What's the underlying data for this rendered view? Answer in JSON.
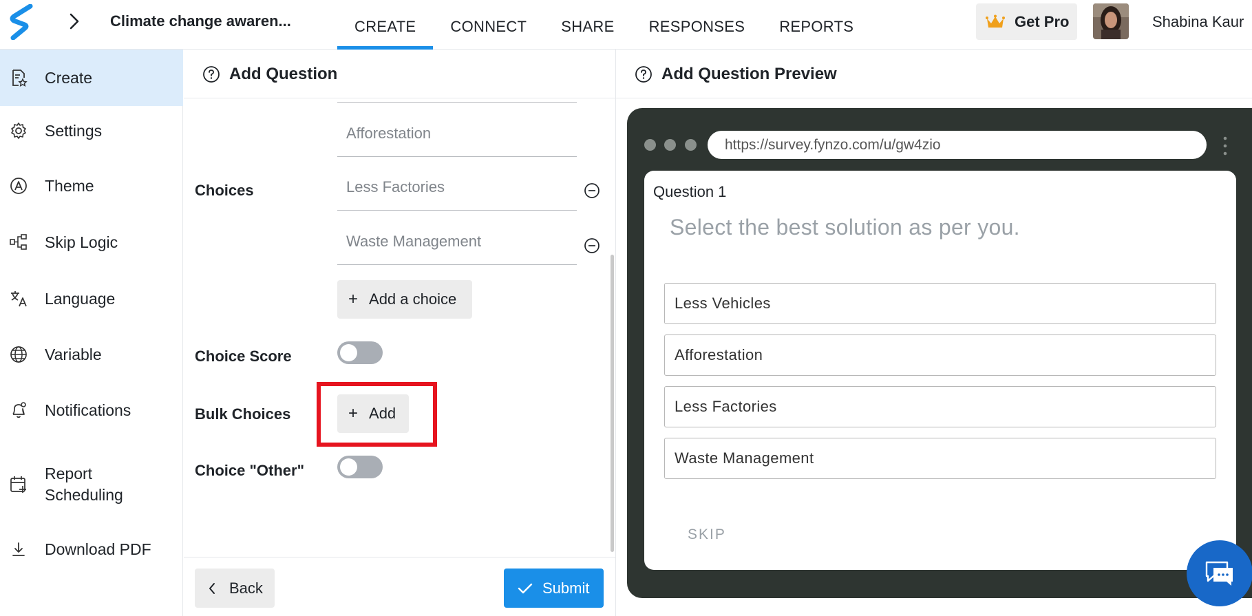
{
  "header": {
    "survey_title": "Climate change awaren...",
    "nav_tabs": [
      {
        "label": "CREATE",
        "active": true
      },
      {
        "label": "CONNECT",
        "active": false
      },
      {
        "label": "SHARE",
        "active": false
      },
      {
        "label": "RESPONSES",
        "active": false
      },
      {
        "label": "REPORTS",
        "active": false
      }
    ],
    "get_pro_label": "Get Pro",
    "username": "Shabina Kaur",
    "accent_color": "#1a8fe8"
  },
  "sidebar": {
    "items": [
      {
        "label": "Create",
        "icon": "create-form-icon",
        "active": true
      },
      {
        "label": "Settings",
        "icon": "gear-icon",
        "active": false
      },
      {
        "label": "Theme",
        "icon": "theme-icon",
        "active": false
      },
      {
        "label": "Skip Logic",
        "icon": "skip-logic-icon",
        "active": false
      },
      {
        "label": "Language",
        "icon": "translate-icon",
        "active": false
      },
      {
        "label": "Variable",
        "icon": "globe-icon",
        "active": false
      },
      {
        "label": "Notifications",
        "icon": "bell-icon",
        "active": false
      },
      {
        "label": "Report Scheduling",
        "icon": "calendar-icon",
        "active": false
      },
      {
        "label": "Download PDF",
        "icon": "download-icon",
        "active": false
      }
    ]
  },
  "editor": {
    "title": "Add Question",
    "choices_label": "Choices",
    "choices": [
      "Afforestation",
      "Less Factories",
      "Waste Management"
    ],
    "add_choice_label": "Add a choice",
    "choice_score_label": "Choice Score",
    "choice_score_on": false,
    "bulk_choices_label": "Bulk Choices",
    "bulk_add_label": "Add",
    "choice_other_label": "Choice \"Other\"",
    "choice_other_on": false,
    "back_label": "Back",
    "submit_label": "Submit"
  },
  "preview": {
    "title": "Add Question Preview",
    "url": "https://survey.fynzo.com/u/gw4zio",
    "question_number": "Question 1",
    "question_text": "Select the best solution as per you.",
    "options": [
      "Less Vehicles",
      "Afforestation",
      "Less Factories",
      "Waste Management"
    ],
    "skip_label": "SKIP"
  }
}
